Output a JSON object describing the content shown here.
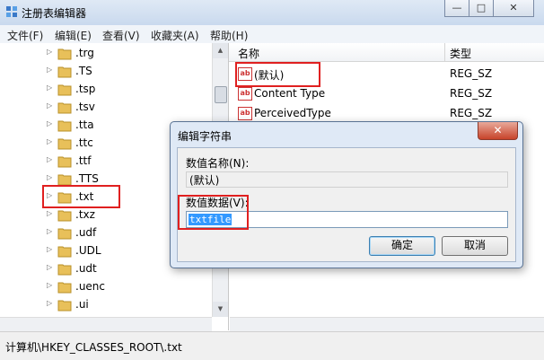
{
  "window": {
    "title": "注册表编辑器",
    "btn_min": "—",
    "btn_max": "□",
    "btn_close": "✕"
  },
  "menu": [
    "文件(F)",
    "编辑(E)",
    "查看(V)",
    "收藏夹(A)",
    "帮助(H)"
  ],
  "tree": {
    "items": [
      ".trg",
      ".TS",
      ".tsp",
      ".tsv",
      ".tta",
      ".ttc",
      ".ttf",
      ".TTS",
      ".txt",
      ".txz",
      ".udf",
      ".UDL",
      ".udt",
      ".uenc",
      ".ui"
    ],
    "selected": ".txt"
  },
  "list": {
    "col_name": "名称",
    "col_type": "类型",
    "rows": [
      {
        "name": "(默认)",
        "type": "REG_SZ"
      },
      {
        "name": "Content Type",
        "type": "REG_SZ"
      },
      {
        "name": "PerceivedType",
        "type": "REG_SZ"
      }
    ]
  },
  "dialog": {
    "title": "编辑字符串",
    "close": "✕",
    "value_name_label": "数值名称(N):",
    "value_name": "(默认)",
    "value_data_label": "数值数据(V):",
    "value_data": "txtfile",
    "ok": "确定",
    "cancel": "取消"
  },
  "status": "计算机\\HKEY_CLASSES_ROOT\\.txt",
  "colors": {
    "highlight": "#e02020",
    "selection": "#3399ff",
    "folder": "#e8c05a"
  }
}
